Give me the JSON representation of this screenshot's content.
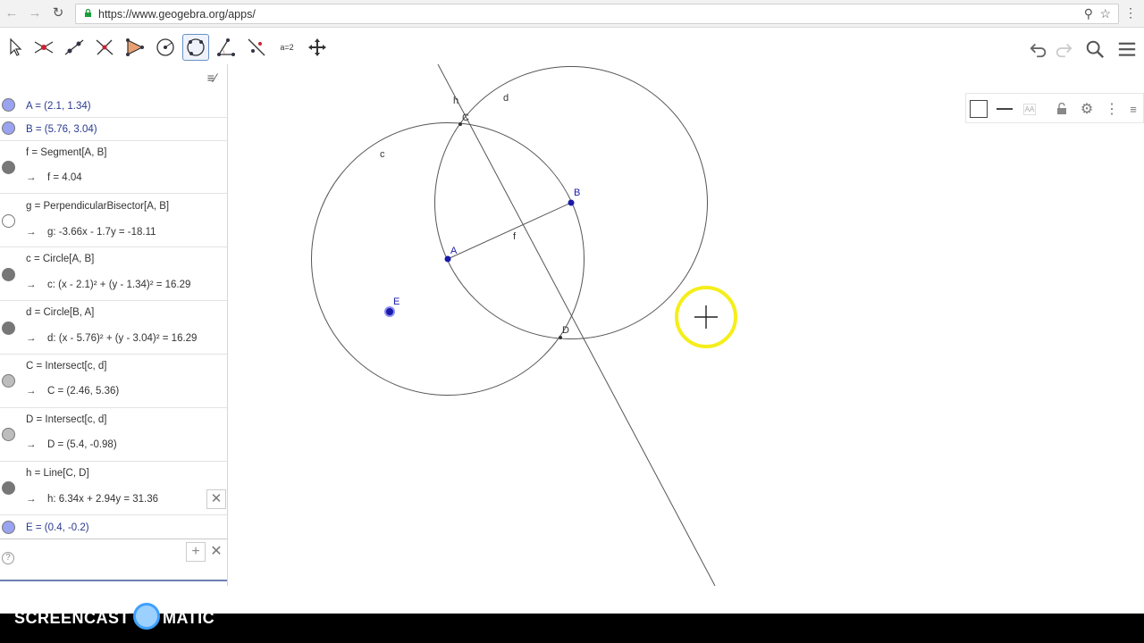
{
  "browser": {
    "url": "https://www.geogebra.org/apps/"
  },
  "toolbar": {
    "tools": [
      "move-tool",
      "intersect-tool",
      "line-tool",
      "perpendicular-line-tool",
      "polygon-tool",
      "circle-center-point-tool",
      "circle-through-points-tool",
      "angle-tool",
      "reflect-tool",
      "slider-tool",
      "move-graphics-view-tool"
    ],
    "slider_label": "a=2",
    "active_tool": "circle-through-points-tool"
  },
  "algebra": {
    "rows": [
      {
        "def": "A = (2.1, 1.34)",
        "val": "",
        "dot": "#9aa3f0"
      },
      {
        "def": "B = (5.76, 3.04)",
        "val": "",
        "dot": "#9aa3f0"
      },
      {
        "def": "f = Segment[A, B]",
        "val": "f = 4.04",
        "dot": "#777777"
      },
      {
        "def": "g = PerpendicularBisector[A, B]",
        "val": "g: -3.66x - 1.7y = -18.11",
        "dot": "#ffffff"
      },
      {
        "def": "c = Circle[A, B]",
        "val": "c: (x - 2.1)² + (y - 1.34)² = 16.29",
        "dot": "#777777"
      },
      {
        "def": "d = Circle[B, A]",
        "val": "d: (x - 5.76)² + (y - 3.04)² = 16.29",
        "dot": "#777777"
      },
      {
        "def": "C = Intersect[c, d]",
        "val": "C = (2.46, 5.36)",
        "dot": "#bdbdbd"
      },
      {
        "def": "D = Intersect[c, d]",
        "val": "D = (5.4, -0.98)",
        "dot": "#bdbdbd"
      },
      {
        "def": "h = Line[C, D]",
        "val": "h: 6.34x + 2.94y = 31.36",
        "dot": "#777777"
      },
      {
        "def": "E = (0.4, -0.2)",
        "val": "",
        "dot": "#9aa3f0"
      }
    ],
    "arrow": "→"
  },
  "graphics": {
    "labels": {
      "h": "h",
      "d": "d",
      "C": "C",
      "c": "c",
      "B": "B",
      "A": "A",
      "f": "f",
      "E": "E",
      "D": "D"
    },
    "point_color": "#1a1aa8",
    "highlight_color": "#f5ee1a"
  },
  "watermark": {
    "small": "RECORDED WITH",
    "left": "SCREENCAST",
    "right": "MATIC"
  },
  "icons": {
    "back": "back-arrow-icon",
    "forward": "forward-arrow-icon",
    "reload": "reload-icon",
    "undo": "undo-icon",
    "redo": "redo-icon",
    "search": "search-icon",
    "menu": "hamburger-menu-icon"
  }
}
